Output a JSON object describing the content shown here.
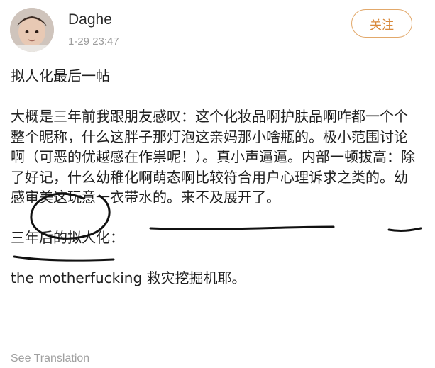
{
  "user": {
    "name": "Daghe",
    "time": "1-29 23:47"
  },
  "follow_label": "关注",
  "post": {
    "title": "拟人化最后一帖",
    "paragraph_1": "大概是三年前我跟朋友感叹：这个化妆品啊护肤品啊咋都一个个整个昵称，什么这胖子那灯泡这亲妈那小啥瓶的。极小范围讨论啊（可恶的优越感在作祟呢！）。真小声逼逼。内部一顿拔高：除了好记，什么幼稚化啊萌态啊比较符合用户心理诉求之类的。幼感审美这玩意一衣带水的。来不及展开了。",
    "paragraph_2": "三年后的拟人化：",
    "paragraph_3": "the motherfucking 救灾挖掘机耶。"
  },
  "see_translation": "See Translation",
  "colors": {
    "accent": "#d9893a",
    "ink": "#111111",
    "muted": "#9b9b9b"
  },
  "icons": {
    "avatar": "baby-portrait-avatar"
  }
}
